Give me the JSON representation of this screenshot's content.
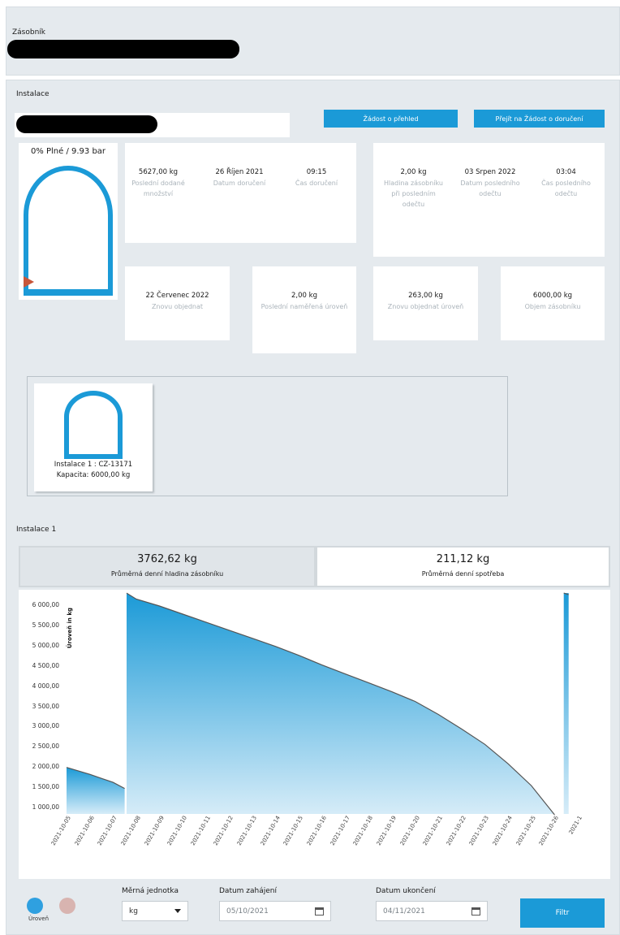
{
  "header": {
    "label": "Zásobník"
  },
  "installation": {
    "label": "Instalace",
    "btn_request_overview": "Žádost o přehled",
    "btn_go_delivery": "Přejít na Žádost o doručení",
    "fill_status": "0% Plné / 9.93 bar"
  },
  "stats_top_left": [
    {
      "value": "5627,00 kg",
      "label": "Poslední dodané množství"
    },
    {
      "value": "26 Říjen 2021",
      "label": "Datum doručení"
    },
    {
      "value": "09:15",
      "label": "Čas doručení"
    }
  ],
  "stats_top_right": [
    {
      "value": "2,00 kg",
      "label": "Hladina zásobníku při posledním odečtu"
    },
    {
      "value": "03 Srpen 2022",
      "label": "Datum posledního odečtu"
    },
    {
      "value": "03:04",
      "label": "Čas posledního odečtu"
    }
  ],
  "stats_row2": [
    {
      "value": "22 Červenec 2022",
      "label": "Znovu objednat"
    },
    {
      "value": "2,00 kg",
      "label": "Poslední naměřená úroveň"
    },
    {
      "value": "263,00 kg",
      "label": "Znovu objednat úroveň"
    },
    {
      "value": "6000,00 kg",
      "label": "Objem zásobníku"
    }
  ],
  "tank_card": {
    "line1": "Instalace 1 : CZ-13171",
    "line2": "Kapacita: 6000,00 kg"
  },
  "section2_title": "Instalace 1",
  "summary": {
    "avg_level_value": "3762,62 kg",
    "avg_level_label": "Průměrná denní hladina zásobníku",
    "avg_consumption_value": "211,12 kg",
    "avg_consumption_label": "Průměrná denní spotřeba"
  },
  "chart_data": {
    "type": "area",
    "ylabel": "Úroveň in kg",
    "y_ticks": [
      "6 000,00",
      "5 500,00",
      "5 000,00",
      "4 500,00",
      "4 000,00",
      "3 500,00",
      "3 000,00",
      "2 500,00",
      "2 000,00",
      "1 500,00",
      "1 000,00"
    ],
    "ylim": [
      1000,
      6000
    ],
    "x_ticks": [
      "2021-10-05",
      "2021-10-06",
      "2021-10-07",
      "2021-10-08",
      "2021-10-09",
      "2021-10-10",
      "2021-10-11",
      "2021-10-12",
      "2021-10-13",
      "2021-10-14",
      "2021-10-15",
      "2021-10-16",
      "2021-10-17",
      "2021-10-18",
      "2021-10-19",
      "2021-10-20",
      "2021-10-21",
      "2021-10-22",
      "2021-10-23",
      "2021-10-24",
      "2021-10-25",
      "2021-10-26",
      "2021-1"
    ],
    "series": [
      {
        "name": "Úroveň",
        "points": [
          [
            "2021-10-05",
            1990
          ],
          [
            "2021-10-06",
            1820
          ],
          [
            "2021-10-07",
            1620
          ],
          [
            "2021-10-07 12:00",
            1470
          ],
          [
            "2021-10-07 14:00",
            6300
          ],
          [
            "2021-10-08",
            6150
          ],
          [
            "2021-10-09",
            5980
          ],
          [
            "2021-10-10",
            5780
          ],
          [
            "2021-10-11",
            5580
          ],
          [
            "2021-10-12",
            5380
          ],
          [
            "2021-10-13",
            5180
          ],
          [
            "2021-10-14",
            4980
          ],
          [
            "2021-10-15",
            4760
          ],
          [
            "2021-10-16",
            4520
          ],
          [
            "2021-10-17",
            4300
          ],
          [
            "2021-10-18",
            4080
          ],
          [
            "2021-10-19",
            3860
          ],
          [
            "2021-10-20",
            3620
          ],
          [
            "2021-10-21",
            3300
          ],
          [
            "2021-10-22",
            2940
          ],
          [
            "2021-10-23",
            2560
          ],
          [
            "2021-10-24",
            2080
          ],
          [
            "2021-10-25",
            1540
          ],
          [
            "2021-10-26",
            820
          ]
        ]
      }
    ],
    "tail_spike": [
      [
        "2021-10-26 12:00",
        6300
      ]
    ],
    "legend": [
      "Úroveň",
      ""
    ]
  },
  "filters": {
    "unit_label": "Měrná jednotka",
    "unit_value": "kg",
    "start_label": "Datum zahájení",
    "start_value": "05/10/2021",
    "end_label": "Datum ukončení",
    "end_value": "04/11/2021",
    "filter_button": "Filtr"
  },
  "colors": {
    "accent": "#1b9ad7",
    "panel": "#e5eaee",
    "legend_second": "#d8b4b0"
  }
}
